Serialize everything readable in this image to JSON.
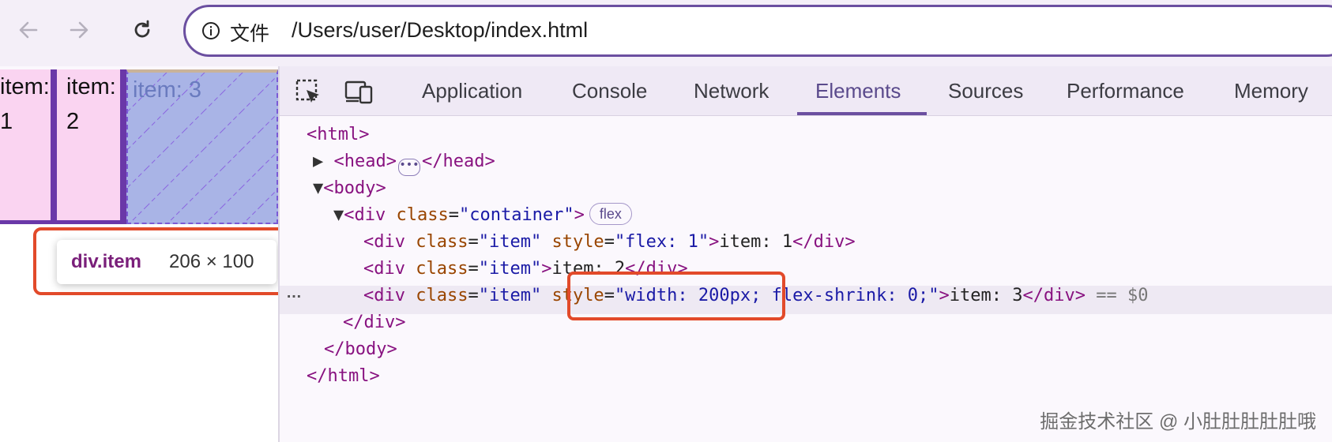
{
  "browser": {
    "url_label": "文件",
    "url_path": "/Users/user/Desktop/index.html"
  },
  "page": {
    "items": [
      "item: 1",
      "item: 2",
      "item: 3"
    ],
    "tooltip_tag": "div.item",
    "tooltip_size": "206 × 100"
  },
  "devtools": {
    "tabs": [
      "Application",
      "Console",
      "Network",
      "Elements",
      "Sources",
      "Performance",
      "Memory"
    ],
    "active_tab": "Elements",
    "flex_badge": "flex",
    "selected_suffix": "== $0",
    "row_marker": "…"
  },
  "dom_lines": {
    "l1": "<html>",
    "l2_open": "<head>",
    "l2_close": "</head>",
    "l3": "<body>",
    "l4_tag": "<div",
    "l4_attr": "class",
    "l4_val": "\"container\"",
    "l4_end": ">",
    "l5_val1": "\"item\"",
    "l5_attr2": "style",
    "l5_val2": "\"flex: 1\"",
    "l5_text": "item: 1",
    "l6_text": "item: 2",
    "l7_attr2": "style",
    "l7_val2a": "\"width: 200px;",
    "l7_val2b": "flex-shrink: 0;\"",
    "l7_text": "item: 3",
    "l8": "</div>",
    "l9": "</body>",
    "l10": "</html>",
    "div_close": "</div>",
    "eq": "="
  },
  "watermark": "掘金技术社区 @ 小肚肚肚肚肚哦",
  "colors": {
    "accent": "#6b4fa0",
    "highlight": "#e24a2a",
    "item_bg": "#fad4f1",
    "item3_bg": "#a9b4e6"
  }
}
